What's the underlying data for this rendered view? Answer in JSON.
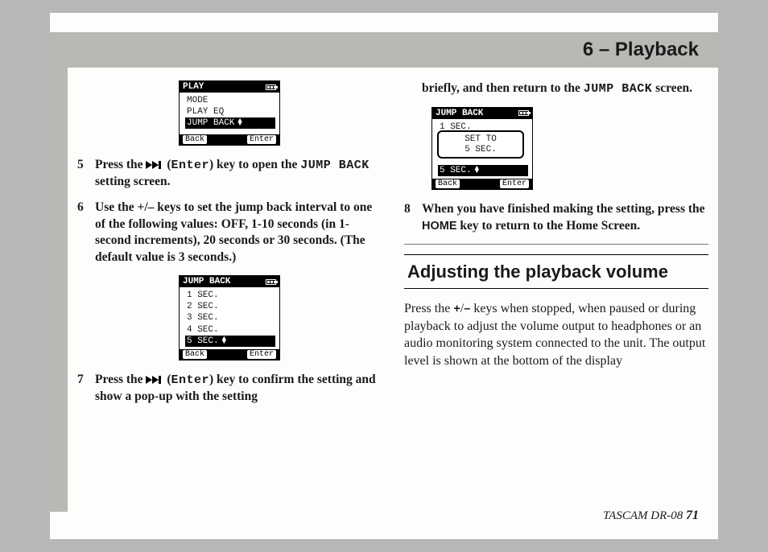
{
  "header": {
    "title": "6 – Playback"
  },
  "footer": {
    "product": "TASCAM  DR-08 ",
    "page": "71"
  },
  "col1": {
    "screen1": {
      "title": "PLAY",
      "rows": [
        "MODE",
        "PLAY EQ",
        "JUMP BACK"
      ],
      "selected": 2,
      "footLeft": "Back",
      "footRight": "Enter"
    },
    "step5": {
      "num": "5",
      "t1": "Press the ",
      "enter": "Enter",
      "t2": ") key to open the ",
      "jump": "JUMP BACK",
      "t3": " setting screen."
    },
    "step6": {
      "num": "6",
      "text": "Use the +/– keys to set the jump back interval to one of the following values: OFF, 1-10 seconds (in 1-second increments), 20 seconds or 30 seconds. (The default value is 3 seconds.)"
    },
    "screen2": {
      "title": "JUMP BACK",
      "rows": [
        "1 SEC.",
        "2 SEC.",
        "3 SEC.",
        "4 SEC.",
        "5 SEC."
      ],
      "selected": 4,
      "footLeft": "Back",
      "footRight": "Enter"
    },
    "step7": {
      "num": "7",
      "t1": "Press the ",
      "enter": "Enter",
      "t2": ") key to confirm the setting and show a pop-up with the setting"
    }
  },
  "col2": {
    "cont": {
      "t1": "briefly, and then return to the ",
      "jump": "JUMP BACK",
      "t2": " screen."
    },
    "screen3": {
      "title": "JUMP BACK",
      "row_top": "1 SEC.",
      "popup_l1": "SET TO",
      "popup_l2": "5 SEC.",
      "row_sel": "5 SEC.",
      "footLeft": "Back",
      "footRight": "Enter"
    },
    "step8": {
      "num": "8",
      "t1": "When you have finished making the setting, press the ",
      "home": "HOME",
      "t2": " key to return to the Home Screen."
    },
    "section": {
      "heading": "Adjusting the playback volume"
    },
    "bodytext": {
      "t1": "Press the ",
      "plus": "+",
      "slash": "/",
      "minus": "–",
      "t2": " keys when stopped, when paused or during playback to adjust the volume output to headphones or an audio monitoring system connected to the unit. The output level is shown at the bottom of the display"
    }
  }
}
